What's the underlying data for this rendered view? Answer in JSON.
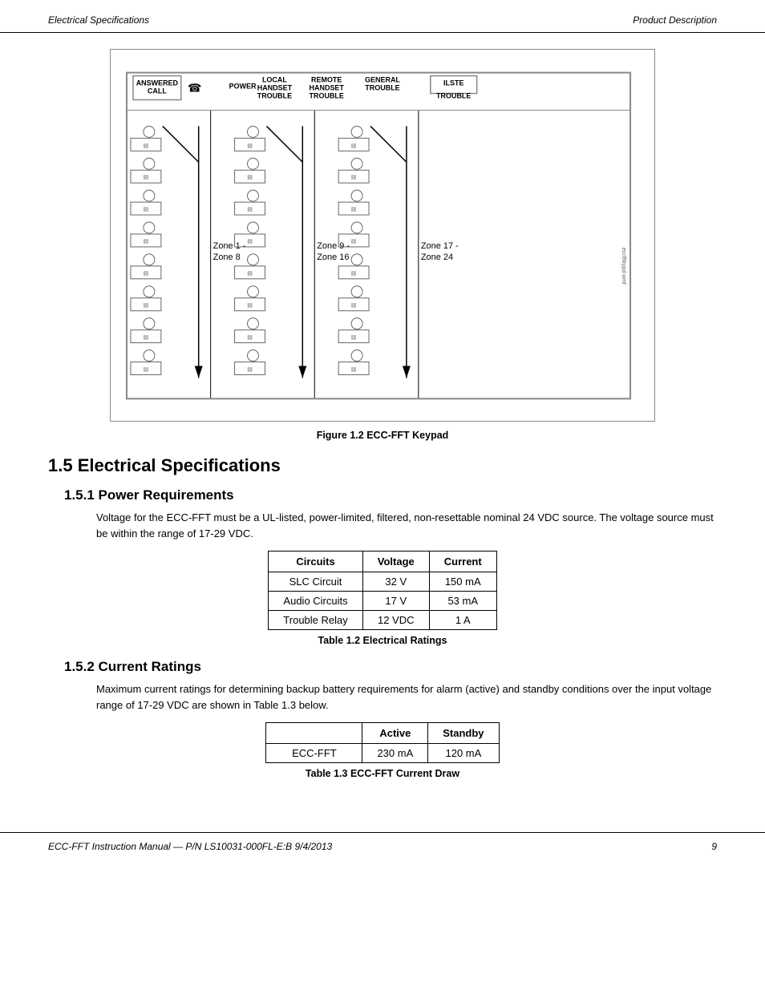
{
  "header": {
    "left": "Electrical Specifications",
    "right": "Product Description"
  },
  "figure": {
    "caption": "Figure 1.2  ECC-FFT Keypad"
  },
  "section_15": {
    "title": "1.5  Electrical Specifications"
  },
  "section_151": {
    "title": "1.5.1  Power Requirements",
    "body": "Voltage for the ECC-FFT must be a UL-listed, power-limited, filtered, non-resettable nominal 24 VDC source. The voltage source must be within the range of 17-29 VDC.",
    "table": {
      "caption": "Table 1.2  Electrical Ratings",
      "headers": [
        "Circuits",
        "Voltage",
        "Current"
      ],
      "rows": [
        [
          "SLC Circuit",
          "32 V",
          "150 mA"
        ],
        [
          "Audio Circuits",
          "17 V",
          "53 mA"
        ],
        [
          "Trouble Relay",
          "12 VDC",
          "1 A"
        ]
      ]
    }
  },
  "section_152": {
    "title": "1.5.2  Current Ratings",
    "body": "Maximum current ratings for determining backup battery requirements for alarm (active) and standby conditions over the input voltage range of 17-29 VDC are shown in Table 1.3 below.",
    "table": {
      "caption": "Table 1.3  ECC-FFT Current Draw",
      "headers": [
        "",
        "Active",
        "Standby"
      ],
      "rows": [
        [
          "ECC-FFT",
          "230 mA",
          "120 mA"
        ]
      ]
    }
  },
  "footer": {
    "left": "ECC-FFT Instruction Manual — P/N LS10031-000FL-E:B  9/4/2013",
    "right": "9"
  }
}
